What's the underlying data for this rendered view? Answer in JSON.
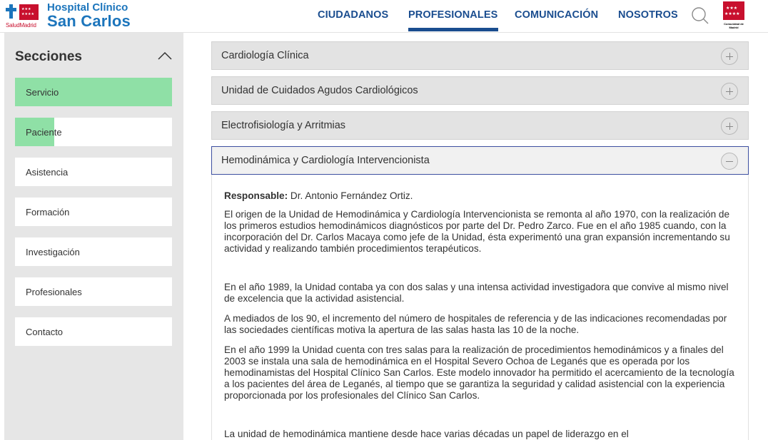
{
  "header": {
    "logo": {
      "line1": "Hospital Clínico",
      "line2": "San Carlos",
      "sub": "SaludMadrid"
    },
    "nav": [
      {
        "label": "CIUDADANOS",
        "active": false
      },
      {
        "label": "PROFESIONALES",
        "active": true
      },
      {
        "label": "COMUNICACIÓN",
        "active": false
      },
      {
        "label": "NOSOTROS",
        "active": false
      }
    ],
    "search_icon": "search-icon",
    "region_logo_text": "Comunidad de Madrid",
    "colors": {
      "brand": "#1c75bc",
      "nav": "#1a4d8f",
      "accent": "#8fe0a6",
      "region_red": "#c8102e"
    }
  },
  "sidebar": {
    "title": "Secciones",
    "toggle_icon": "chevron-up-icon",
    "items": [
      {
        "label": "Servicio",
        "progress": 1.0
      },
      {
        "label": "Paciente",
        "progress": 0.25
      },
      {
        "label": "Asistencia",
        "progress": 0
      },
      {
        "label": "Formación",
        "progress": 0
      },
      {
        "label": "Investigación",
        "progress": 0
      },
      {
        "label": "Profesionales",
        "progress": 0
      },
      {
        "label": "Contacto",
        "progress": 0
      }
    ]
  },
  "accordion": [
    {
      "title": "Cardiología Clínica",
      "expanded": false
    },
    {
      "title": "Unidad de Cuidados Agudos Cardiológicos",
      "expanded": false
    },
    {
      "title": "Electrofisiología y Arritmias",
      "expanded": false
    },
    {
      "title": "Hemodinámica y Cardiología Intervencionista",
      "expanded": true
    }
  ],
  "content": {
    "responsable_label": "Responsable:",
    "responsable_name": "Dr. Antonio Fernández Ortiz.",
    "paragraphs": [
      "El origen de la Unidad de Hemodinámica y Cardiología Intervencionista se remonta al año 1970, con la realización de los primeros estudios hemodinámicos diagnósticos por parte del Dr. Pedro Zarco. Fue en el año 1985 cuando, con la incorporación del Dr. Carlos Macaya como jefe de la Unidad, ésta experimentó una gran expansión incrementando su actividad y realizando también procedimientos terapéuticos.",
      "En el año 1989, la Unidad contaba ya con dos salas y una intensa actividad investigadora que convive al mismo nivel de excelencia que la actividad asistencial.",
      "A mediados de los 90, el incremento del número de hospitales de referencia y de las indicaciones recomendadas por las sociedades científicas motiva la apertura de las salas hasta las 10 de la noche.",
      "En el año 1999 la Unidad cuenta con tres salas para la realización de procedimientos hemodinámicos y a finales del 2003 se instala una sala de hemodinámica en el Hospital Severo Ochoa de Leganés que es operada por los hemodinamistas del Hospital Clínico San Carlos. Este modelo innovador ha permitido el acercamiento de la tecnología a los pacientes del área de Leganés, al tiempo que se garantiza la seguridad y calidad asistencial con la experiencia proporcionada por los profesionales del Clínico San Carlos.",
      "La unidad de hemodinámica mantiene desde hace varias décadas un papel de liderazgo en el"
    ]
  }
}
